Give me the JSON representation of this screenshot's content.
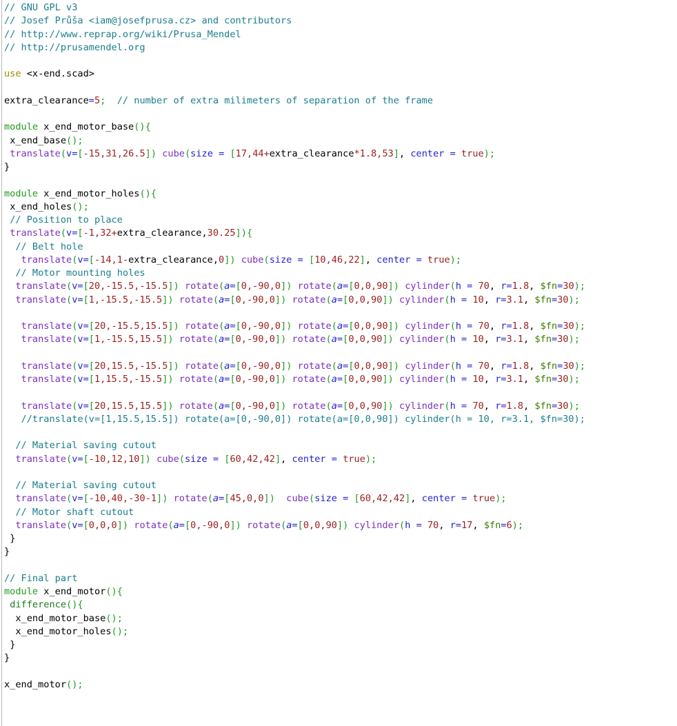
{
  "editor": {
    "language": "openscad",
    "filename_hint": "x-end-motor.scad",
    "background": "#ffffff",
    "gutter_rule_color": "#b9b9b9",
    "colors": {
      "comment": "#1a7e8c",
      "keyword_module": "#1f9b1f",
      "keyword_use": "#9b8b00",
      "builtin_transform": "#7b2fbe",
      "builtin_csg": "#1f7a1f",
      "bracket": "#1f9b1f",
      "number": "#9b2020",
      "argument": "#2222cc",
      "operator": "#2222cc",
      "special_variable": "#3d7a00",
      "identifier": "#000000"
    }
  },
  "code": {
    "l1": "// GNU GPL v3",
    "l2": "// Josef Průša <iam@josefprusa.cz> and contributors",
    "l3": "// http://www.reprap.org/wiki/Prusa_Mendel",
    "l4": "// http://prusamendel.org",
    "l6_use_kw": "use",
    "l6_path": "<x-end.scad>",
    "l8_var": "extra_clearance",
    "l8_eq": "=",
    "l8_val": "5",
    "l8_semi": ";",
    "l8_comment": "// number of extra milimeters of separation of the frame",
    "l10_module": "module",
    "l10_name": "x_end_motor_base",
    "l10_open": "(){",
    "l11_call": "x_end_base",
    "l11_tail": "();",
    "l12_fn": "translate",
    "l12_arg": "v",
    "l12_vec": "-15,31,26.5",
    "l12_fn2": "cube",
    "l12_arg2": "size",
    "l12_vec2a": "17,44",
    "l12_plus": "+",
    "l12_ident": "extra_clearance",
    "l12_star": "*",
    "l12_vec2b": "1.8,53",
    "l12_arg3": "center",
    "l12_true": "true",
    "l13_close": "}",
    "l15_module": "module",
    "l15_name": "x_end_motor_holes",
    "l16_call": "x_end_holes",
    "l17_comment": "// Position to place",
    "l18_fn": "translate",
    "l18_arg": "v",
    "l18_vec_a": "-1,32",
    "l18_plus": "+",
    "l18_ident": "extra_clearance",
    "l18_vec_b": "30.25",
    "l18_open": "]){",
    "l19_comment": "// Belt hole",
    "l20_fn": "translate",
    "l20_vec_a": "-14,1",
    "l20_minus": "-",
    "l20_ident": "extra_clearance",
    "l20_vec_b": "0",
    "l20_fn2": "cube",
    "l20_size": "10,46,22",
    "l20_true": "true",
    "l21_comment": "// Motor mounting holes",
    "rows": [
      {
        "indent": 1,
        "t_vec": "20,-15.5,-15.5",
        "r1": "0,-90,0",
        "r2": "0,0,90",
        "h": "70",
        "r": "1.8",
        "fn": "30",
        "commented": false
      },
      {
        "indent": 1,
        "t_vec": "1,-15.5,-15.5",
        "r1": "0,-90,0",
        "r2": "0,0,90",
        "h": "10",
        "r": "3.1",
        "fn": "30",
        "commented": false
      },
      {
        "indent": 2,
        "t_vec": "20,-15.5,15.5",
        "r1": "0,-90,0",
        "r2": "0,0,90",
        "h": "70",
        "r": "1.8",
        "fn": "30",
        "commented": false
      },
      {
        "indent": 2,
        "t_vec": "1,-15.5,15.5",
        "r1": "0,-90,0",
        "r2": "0,0,90",
        "h": "10",
        "r": "3.1",
        "fn": "30",
        "commented": false
      },
      {
        "indent": 2,
        "t_vec": "20,15.5,-15.5",
        "r1": "0,-90,0",
        "r2": "0,0,90",
        "h": "70",
        "r": "1.8",
        "fn": "30",
        "commented": false
      },
      {
        "indent": 2,
        "t_vec": "1,15.5,-15.5",
        "r1": "0,-90,0",
        "r2": "0,0,90",
        "h": "10",
        "r": "3.1",
        "fn": "30",
        "commented": false
      },
      {
        "indent": 2,
        "t_vec": "20,15.5,15.5",
        "r1": "0,-90,0",
        "r2": "0,0,90",
        "h": "70",
        "r": "1.8",
        "fn": "30",
        "commented": false
      },
      {
        "indent": 2,
        "t_vec": "1,15.5,15.5",
        "r1": "0,-90,0",
        "r2": "0,0,90",
        "h": "10",
        "r": "3.1",
        "fn": "30",
        "commented": true
      }
    ],
    "l36_comment": "// Material saving cutout",
    "l37_vec": "-10,12,10",
    "l37_size": "60,42,42",
    "l39_comment": "// Material saving cutout",
    "l40_vec_a": "-10,40,-30",
    "l40_minus": "-",
    "l40_vec_b": "1",
    "l40_rot": "45,0,0",
    "l40_size": "60,42,42",
    "l41_comment": "// Motor shaft cutout",
    "l42_vec": "0,0,0",
    "l42_r1": "0,-90,0",
    "l42_r2": "0,0,90",
    "l42_h": "70",
    "l42_r": "17",
    "l42_fn": "6",
    "l45_comment": "// Final part",
    "l46_module": "module",
    "l46_name": "x_end_motor",
    "l47_diff": "difference",
    "l48_call": "x_end_motor_base",
    "l49_call": "x_end_motor_holes",
    "l53_call": "x_end_motor",
    "tok": {
      "cube": "cube",
      "cylinder": "cylinder",
      "translate": "translate",
      "rotate": "rotate",
      "paren_open": "(",
      "paren_close": ")",
      "bracket_open": "[",
      "bracket_close": "]",
      "brace_open": "{",
      "brace_close": "}",
      "semicolon": ";",
      "comma": ",",
      "eq": "=",
      "eq_spaced": " = ",
      "v": "v",
      "a": "a",
      "h": "h",
      "r": "r",
      "size": "size",
      "center": "center",
      "fn": "$fn",
      "true": "true",
      "slash_slash": "//"
    }
  }
}
